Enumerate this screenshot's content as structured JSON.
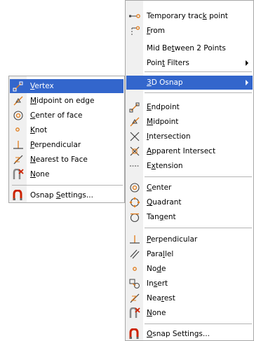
{
  "main_menu": {
    "items": [
      {
        "pre": "Temporary trac",
        "ul": "k",
        "post": " point",
        "icon": "temporary-track-icon"
      },
      {
        "pre": "",
        "ul": "F",
        "post": "rom",
        "icon": "from-icon"
      },
      {
        "pre": "Mid Be",
        "ul": "t",
        "post": "ween 2 Points",
        "icon": ""
      },
      {
        "pre": "Poin",
        "ul": "t",
        "post": " Filters",
        "icon": "",
        "submenu": true
      },
      {
        "pre": "",
        "ul": "3",
        "post": "D Osnap",
        "icon": "",
        "submenu": true,
        "highlighted": true
      },
      {
        "pre": "",
        "ul": "E",
        "post": "ndpoint",
        "icon": "endpoint-icon"
      },
      {
        "pre": "",
        "ul": "M",
        "post": "idpoint",
        "icon": "midpoint-icon"
      },
      {
        "pre": "",
        "ul": "I",
        "post": "ntersection",
        "icon": "intersection-icon"
      },
      {
        "pre": "",
        "ul": "A",
        "post": "pparent Intersect",
        "icon": "apparent-intersect-icon"
      },
      {
        "pre": "E",
        "ul": "x",
        "post": "tension",
        "icon": "extension-icon"
      },
      {
        "pre": "",
        "ul": "C",
        "post": "enter",
        "icon": "center-icon"
      },
      {
        "pre": "",
        "ul": "Q",
        "post": "uadrant",
        "icon": "quadrant-icon"
      },
      {
        "pre": "Tan",
        "ul": "g",
        "post": "ent",
        "icon": "tangent-icon"
      },
      {
        "pre": "",
        "ul": "P",
        "post": "erpendicular",
        "icon": "perpendicular-icon"
      },
      {
        "pre": "Para",
        "ul": "l",
        "post": "lel",
        "icon": "parallel-icon"
      },
      {
        "pre": "No",
        "ul": "d",
        "post": "e",
        "icon": "node-icon"
      },
      {
        "pre": "In",
        "ul": "s",
        "post": "ert",
        "icon": "insert-icon"
      },
      {
        "pre": "Nea",
        "ul": "r",
        "post": "est",
        "icon": "nearest-icon"
      },
      {
        "pre": "",
        "ul": "N",
        "post": "one",
        "icon": "none-icon"
      },
      {
        "pre": "",
        "ul": "O",
        "post": "snap Settings...",
        "icon": "osnap-settings-icon"
      }
    ]
  },
  "sub_menu": {
    "items": [
      {
        "pre": "",
        "ul": "V",
        "post": "ertex",
        "icon": "vertex-icon",
        "highlighted": true
      },
      {
        "pre": "",
        "ul": "M",
        "post": "idpoint on edge",
        "icon": "midpoint-on-edge-icon"
      },
      {
        "pre": "",
        "ul": "C",
        "post": "enter of face",
        "icon": "center-of-face-icon"
      },
      {
        "pre": "",
        "ul": "K",
        "post": "not",
        "icon": "knot-icon"
      },
      {
        "pre": "",
        "ul": "P",
        "post": "erpendicular",
        "icon": "perpendicular-icon"
      },
      {
        "pre": "",
        "ul": "N",
        "post": "earest to Face",
        "icon": "nearest-to-face-icon"
      },
      {
        "pre": "",
        "ul": "N",
        "post": "one",
        "icon": "none-icon"
      },
      {
        "pre": "Osnap ",
        "ul": "S",
        "post": "ettings...",
        "icon": "osnap-settings-icon"
      }
    ]
  },
  "colors": {
    "highlight": "#3366cc",
    "menu_background": "#ffffff",
    "icon_gutter": "#f0f0f0",
    "separator": "#b4b4b4",
    "icon_orange": "#e07b1a",
    "icon_red": "#cc2200"
  }
}
